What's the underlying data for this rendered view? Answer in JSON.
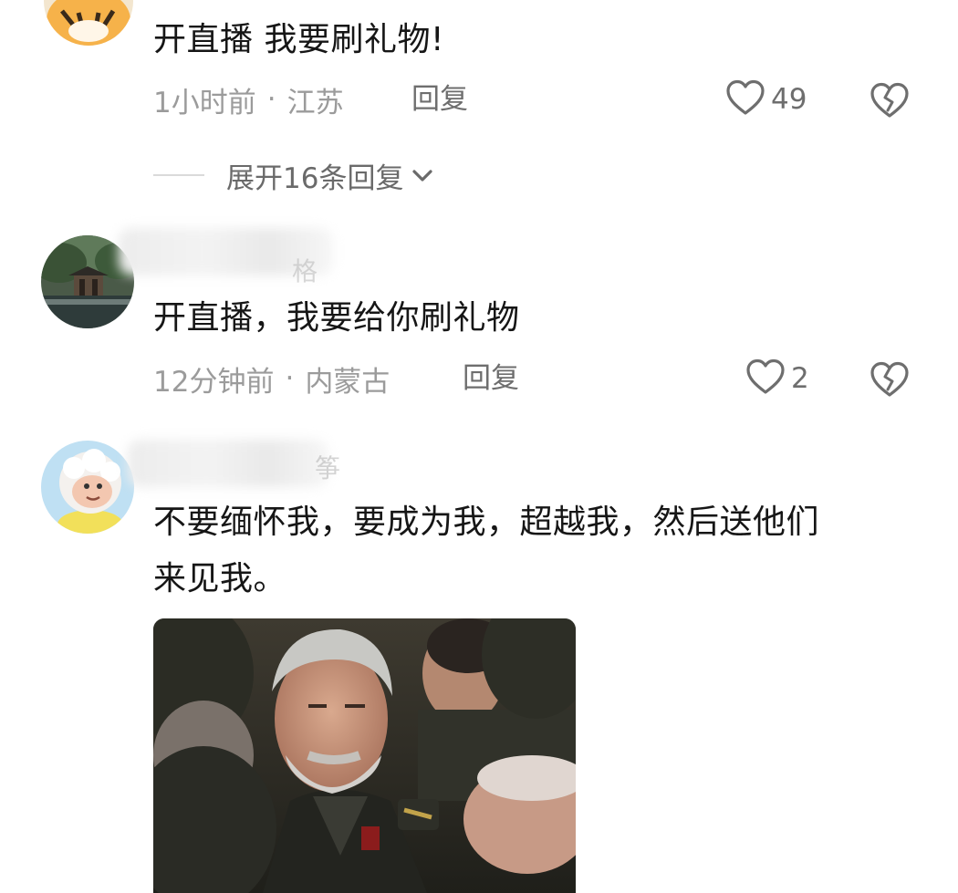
{
  "comments": [
    {
      "text": "开直播 我要刷礼物!",
      "time": "1小时前",
      "location": "江苏",
      "reply_label": "回复",
      "likes": "49",
      "expand_label": "展开16条回复"
    },
    {
      "username_tail": "格",
      "text": "开直播，我要给你刷礼物",
      "time": "12分钟前",
      "location": "内蒙古",
      "reply_label": "回复",
      "likes": "2"
    },
    {
      "username_tail": "筝",
      "text_line1": "不要缅怀我，要成为我，超越我，然后送他们",
      "text_line2": "来见我。"
    }
  ],
  "separator": "·",
  "colors": {
    "text": "#161616",
    "meta": "#9b9b9b",
    "action": "#6e6e6e"
  }
}
